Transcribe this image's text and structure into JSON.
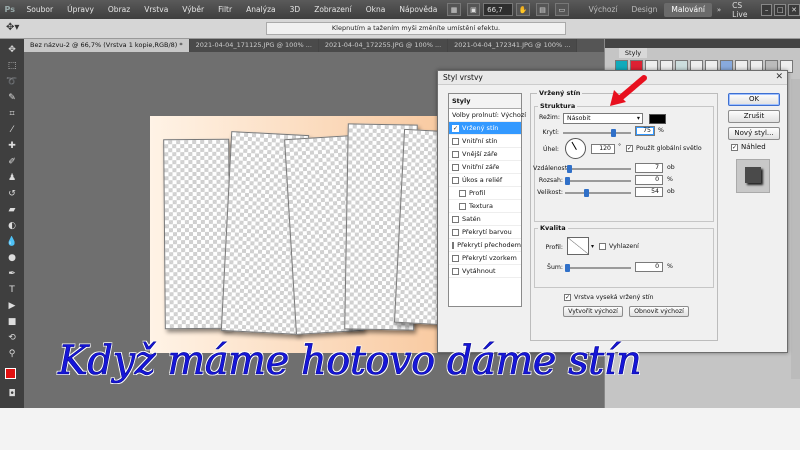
{
  "app": {
    "logo": "Ps",
    "menu": [
      "Soubor",
      "Úpravy",
      "Obraz",
      "Vrstva",
      "Výběr",
      "Filtr",
      "Analýza",
      "3D",
      "Zobrazení",
      "Okna",
      "Nápověda"
    ],
    "zoom": "66,7",
    "workspaces": [
      "Výchozí",
      "Design",
      "Malování"
    ],
    "active_workspace": "Malování",
    "cs_live": "CS Live",
    "hint": "Klepnutím a tažením myši změníte umístění efektu."
  },
  "tabs": [
    "Bez názvu-2 @ 66,7% (Vrstva 1 kopie,RGB/8) *",
    "2021-04-04_171125.JPG @ 100% ...",
    "2021-04-04_172255.JPG @ 100% ...",
    "2021-04-04_172341.JPG @ 100% ..."
  ],
  "dock": {
    "panel_tab": "Styly"
  },
  "dialog": {
    "title": "Styl vrstvy",
    "list_header": "Styly",
    "items": [
      {
        "label": "Volby prolnutí: Výchozí",
        "checkbox": false,
        "checked": false,
        "indent": false,
        "active": false
      },
      {
        "label": "Vržený stín",
        "checkbox": true,
        "checked": true,
        "indent": false,
        "active": true
      },
      {
        "label": "Vnitřní stín",
        "checkbox": true,
        "checked": false,
        "indent": false,
        "active": false
      },
      {
        "label": "Vnější záře",
        "checkbox": true,
        "checked": false,
        "indent": false,
        "active": false
      },
      {
        "label": "Vnitřní záře",
        "checkbox": true,
        "checked": false,
        "indent": false,
        "active": false
      },
      {
        "label": "Úkos a reliéf",
        "checkbox": true,
        "checked": false,
        "indent": false,
        "active": false
      },
      {
        "label": "Profil",
        "checkbox": true,
        "checked": false,
        "indent": true,
        "active": false
      },
      {
        "label": "Textura",
        "checkbox": true,
        "checked": false,
        "indent": true,
        "active": false
      },
      {
        "label": "Satén",
        "checkbox": true,
        "checked": false,
        "indent": false,
        "active": false
      },
      {
        "label": "Překrytí barvou",
        "checkbox": true,
        "checked": false,
        "indent": false,
        "active": false
      },
      {
        "label": "Překrytí přechodem",
        "checkbox": true,
        "checked": false,
        "indent": false,
        "active": false
      },
      {
        "label": "Překrytí vzorkem",
        "checkbox": true,
        "checked": false,
        "indent": false,
        "active": false
      },
      {
        "label": "Vytáhnout",
        "checkbox": true,
        "checked": false,
        "indent": false,
        "active": false
      }
    ],
    "section_title": "Vržený stín",
    "structure_title": "Struktura",
    "mode_label": "Režim:",
    "mode_value": "Násobit",
    "opacity_label": "Krytí:",
    "opacity_value": "75",
    "opacity_unit": "%",
    "opacity_fraction": 0.75,
    "angle_label": "Úhel:",
    "angle_value": "120",
    "angle_unit": "°",
    "global_light_label": "Použít globální světlo",
    "distance_label": "Vzdálenost:",
    "distance_value": "7",
    "distance_unit": "ob",
    "spread_label": "Rozsah:",
    "spread_value": "0",
    "spread_unit": "%",
    "size_label": "Velikost:",
    "size_value": "54",
    "size_unit": "ob",
    "quality_title": "Kvalita",
    "contour_label": "Profil:",
    "antialias_label": "Vyhlazení",
    "noise_label": "Šum:",
    "noise_value": "0",
    "noise_unit": "%",
    "knockout_label": "Vrstva vyseká vržený stín",
    "make_default": "Vytvořit výchozí",
    "reset_default": "Obnovit výchozí",
    "ok": "OK",
    "cancel": "Zrušit",
    "new_style": "Nový styl...",
    "preview_label": "Náhled",
    "shadow_color": "#000000"
  },
  "caption": "Když máme hotovo dáme stín",
  "colors": {
    "foreground": "#e21010",
    "background": "#ffffff",
    "caption": "#1616d8",
    "accent_arrow": "#e8101e"
  }
}
